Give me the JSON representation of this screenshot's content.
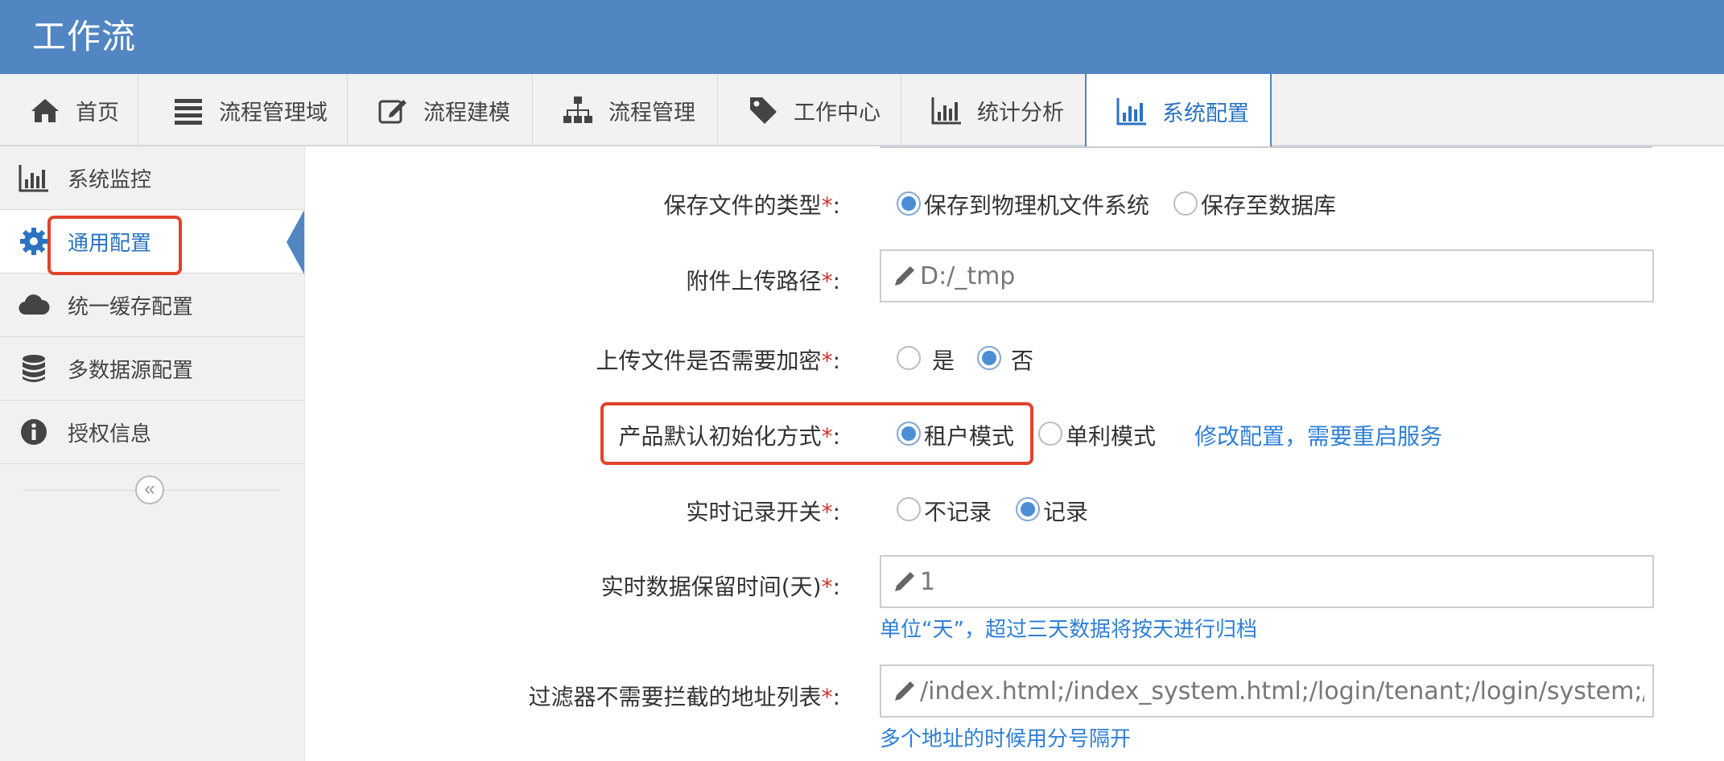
{
  "app": {
    "title": "工作流"
  },
  "nav": {
    "items": [
      {
        "label": "首页",
        "icon": "home-icon"
      },
      {
        "label": "流程管理域",
        "icon": "list-icon"
      },
      {
        "label": "流程建模",
        "icon": "edit-icon"
      },
      {
        "label": "流程管理",
        "icon": "sitemap-icon"
      },
      {
        "label": "工作中心",
        "icon": "tag-icon"
      },
      {
        "label": "统计分析",
        "icon": "bar-chart-icon"
      },
      {
        "label": "系统配置",
        "icon": "bar-chart-icon",
        "active": true
      }
    ]
  },
  "sidebar": {
    "items": [
      {
        "label": "系统监控",
        "icon": "bar-chart-icon"
      },
      {
        "label": "通用配置",
        "icon": "gear-icon",
        "active": true
      },
      {
        "label": "统一缓存配置",
        "icon": "cloud-icon"
      },
      {
        "label": "多数据源配置",
        "icon": "database-icon"
      },
      {
        "label": "授权信息",
        "icon": "info-icon"
      }
    ],
    "collapse_glyph": "«"
  },
  "form": {
    "required_mark": "*",
    "file_type": {
      "label": "保存文件的类型",
      "options": [
        "保存到物理机文件系统",
        "保存至数据库"
      ],
      "selected": 0
    },
    "upload_path": {
      "label": "附件上传路径",
      "value": "D:/_tmp"
    },
    "encrypt": {
      "label": "上传文件是否需要加密",
      "options": [
        "是",
        "否"
      ],
      "selected": 1
    },
    "init_mode": {
      "label": "产品默认初始化方式",
      "options": [
        "租户模式",
        "单利模式"
      ],
      "selected": 0,
      "link": "修改配置，需要重启服务"
    },
    "realtime_record": {
      "label": "实时记录开关",
      "options": [
        "不记录",
        "记录"
      ],
      "selected": 1
    },
    "retention_days": {
      "label": "实时数据保留时间(天)",
      "value": "1",
      "hint": "单位“天”，超过三天数据将按天进行归档"
    },
    "filter_urls": {
      "label": "过滤器不需要拦截的地址列表",
      "value": "/index.html;/index_system.html;/login/tenant;/login/system;/system",
      "hint": "多个地址的时候用分号隔开"
    }
  },
  "colors": {
    "header": "#5186c2",
    "accent": "#2b73c2",
    "link": "#2f7fd6",
    "required": "#d0342c",
    "highlight_box": "#e0432b"
  }
}
